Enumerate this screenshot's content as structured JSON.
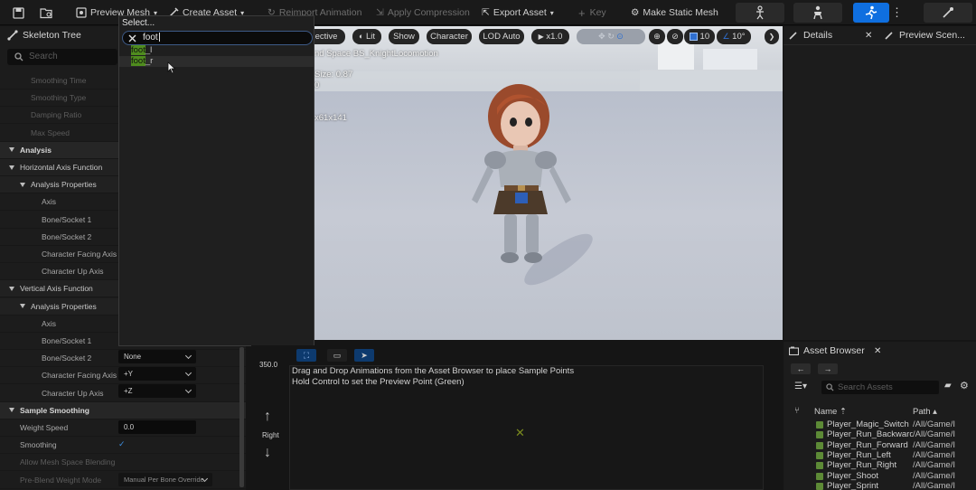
{
  "toolbar": {
    "save_label": "",
    "preview_mesh": "Preview Mesh",
    "create_asset": "Create Asset",
    "reimport": "Reimport Animation",
    "apply_compression": "Apply Compression",
    "export_asset": "Export Asset",
    "key": "Key",
    "make_static_mesh": "Make Static Mesh"
  },
  "left_panel": {
    "tab_skeleton_tree": "Skeleton Tree",
    "search_placeholder": "Search",
    "rows": [
      {
        "label": "Smoothing Time",
        "kind": "dim2"
      },
      {
        "label": "Smoothing Type",
        "kind": "dim2"
      },
      {
        "label": "Damping Ratio",
        "kind": "dim2"
      },
      {
        "label": "Max Speed",
        "kind": "dim2"
      },
      {
        "label": "Analysis",
        "kind": "cat"
      },
      {
        "label": "Horizontal Axis Function",
        "kind": "sub"
      },
      {
        "label": "Analysis Properties",
        "kind": "sub2"
      },
      {
        "label": "Axis",
        "kind": "leaf"
      },
      {
        "label": "Bone/Socket 1",
        "kind": "leaf"
      },
      {
        "label": "Bone/Socket 2",
        "kind": "leaf"
      },
      {
        "label": "Character Facing Axis",
        "kind": "leaf"
      },
      {
        "label": "Character Up Axis",
        "kind": "leaf"
      },
      {
        "label": "Vertical Axis Function",
        "kind": "sub"
      },
      {
        "label": "Analysis Properties",
        "kind": "sub2"
      },
      {
        "label": "Axis",
        "kind": "leaf"
      },
      {
        "label": "Bone/Socket 1",
        "kind": "leaf"
      },
      {
        "label": "Bone/Socket 2",
        "kind": "leaf"
      },
      {
        "label": "Character Facing Axis",
        "kind": "leaf"
      },
      {
        "label": "Character Up Axis",
        "kind": "leaf"
      },
      {
        "label": "Sample Smoothing",
        "kind": "cat"
      },
      {
        "label": "Weight Speed",
        "kind": "leaf0"
      },
      {
        "label": "Smoothing",
        "kind": "leaf0"
      },
      {
        "label": "Allow Mesh Space Blending",
        "kind": "dim0"
      },
      {
        "label": "Pre-Blend Weight Mode",
        "kind": "dim0"
      }
    ],
    "bone_socket_2_value": "None",
    "facing_axis_value": "+Y",
    "up_axis_value": "+Z",
    "weight_speed_value": "0.0",
    "smoothing_checked": "✓",
    "preblend_value": "Manual Per Bone Override"
  },
  "select_popup": {
    "title": "Select...",
    "search_value": "foot",
    "items": [
      {
        "match": "foot",
        "rest": "_l"
      },
      {
        "match": "foot",
        "rest": "_r"
      }
    ]
  },
  "viewport": {
    "toolbar": {
      "perspective": "ective",
      "lit": "Lit",
      "show": "Show",
      "character": "Character",
      "lod": "LOD Auto",
      "speed": "x1.0",
      "grid_value": "10",
      "angle_value": "10°"
    },
    "overlay_line1": "nd Space BS_KnightLocomotion",
    "overlay_line2": "Size: 0.87",
    "overlay_line3": "0",
    "overlay_line4": "x61x141"
  },
  "details": {
    "tab_details": "Details",
    "tab_preview": "Preview Scen..."
  },
  "asset_browser": {
    "tab": "Asset Browser",
    "search_placeholder": "Search Assets",
    "col_name": "Name",
    "col_path": "Path",
    "rows": [
      {
        "name": "Player_Magic_Switch",
        "path": "/All/Game/I"
      },
      {
        "name": "Player_Run_Backward",
        "path": "/All/Game/I"
      },
      {
        "name": "Player_Run_Forward",
        "path": "/All/Game/I"
      },
      {
        "name": "Player_Run_Left",
        "path": "/All/Game/I"
      },
      {
        "name": "Player_Run_Right",
        "path": "/All/Game/I"
      },
      {
        "name": "Player_Shoot",
        "path": "/All/Game/I"
      },
      {
        "name": "Player_Sprint",
        "path": "/All/Game/I"
      }
    ]
  },
  "graph": {
    "y_max": "350.0",
    "axis_label": "Right",
    "hint1": "Drag and Drop Animations from the Asset Browser to place Sample Points",
    "hint2": "Hold Control to set the Preview Point (Green)",
    "marker": "✕"
  },
  "colors": {
    "accent": "#0f6fe0",
    "highlight": "#4f8c1e",
    "preview_point": "#7a8a1e"
  }
}
